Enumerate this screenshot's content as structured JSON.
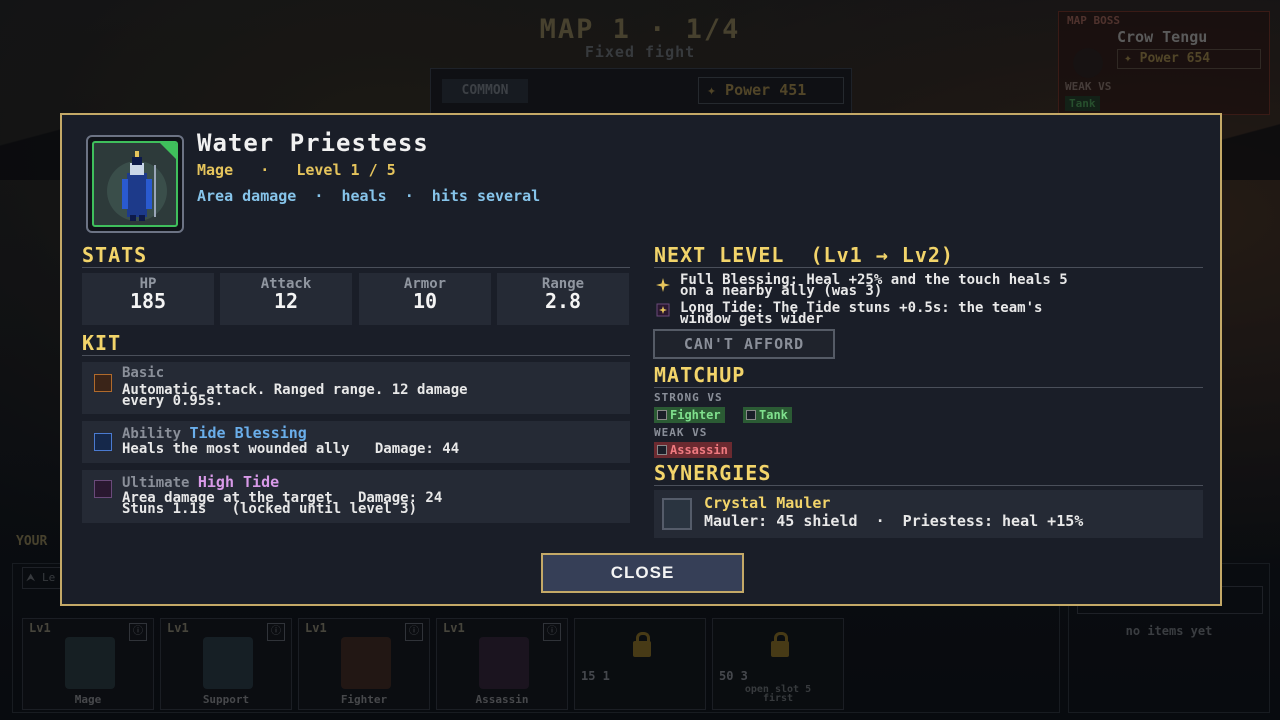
{
  "background": {
    "map_title": "MAP 1  ·  1/4",
    "map_subtitle": "Fixed fight",
    "rarity": "COMMON",
    "power": "✦ Power 451",
    "boss": {
      "label": "MAP BOSS",
      "name": "Crow Tengu",
      "power": "✦ Power 654",
      "weak_label": "WEAK VS",
      "weak_tag": "Tank"
    },
    "team_label": "YOUR",
    "team_tab": "⮝ Le",
    "slots": [
      {
        "level": "Lv1",
        "info": "ⓘ",
        "name": "Mage"
      },
      {
        "level": "Lv1",
        "info": "ⓘ",
        "name": "Support"
      },
      {
        "level": "Lv1",
        "info": "ⓘ",
        "name": "Fighter"
      },
      {
        "level": "Lv1",
        "info": "ⓘ",
        "name": "Assassin"
      }
    ],
    "locked_slots": [
      {
        "cost": "15 1",
        "note": ""
      },
      {
        "cost": "50 3",
        "note": "open slot 5\nfirst"
      }
    ],
    "items_empty": "no items yet"
  },
  "modal": {
    "unit_name": "Water Priestess",
    "unit_class": "Mage   ·   Level 1 / 5",
    "unit_tags": "Area damage  ·  heals  ·  hits several",
    "stats_title": "STATS",
    "stats": [
      {
        "label": "HP",
        "value": "185"
      },
      {
        "label": "Attack",
        "value": "12"
      },
      {
        "label": "Armor",
        "value": "10"
      },
      {
        "label": "Range",
        "value": "2.8"
      }
    ],
    "kit_title": "KIT",
    "kit": {
      "basic_type": "Basic",
      "basic_text": "Automatic attack. Ranged range. 12 damage\nevery 0.95s.",
      "ability_type": "Ability ",
      "ability_name": "Tide Blessing",
      "ability_text": "Heals the most wounded ally   Damage: 44",
      "ult_type": "Ultimate ",
      "ult_name": "High Tide",
      "ult_text": "Area damage at the target   Damage: 24\nStuns 1.1s   (locked until level 3)"
    },
    "next_title": "NEXT LEVEL  (Lv1 → Lv2)",
    "upgrades": [
      "Full Blessing: Heal +25% and the touch heals 5\non a nearby ally (was 3)",
      "Long Tide: The Tide stuns +0.5s: the team's\nwindow gets wider"
    ],
    "afford_label": "CAN'T AFFORD",
    "matchup_title": "MATCHUP",
    "strong_label": "STRONG VS",
    "strong_tags": [
      "Fighter",
      "Tank"
    ],
    "weak_label": "WEAK VS",
    "weak_tags": [
      "Assassin"
    ],
    "synergies_title": "SYNERGIES",
    "synergy": {
      "name": "Crystal Mauler",
      "desc": "Mauler: 45 shield  ·  Priestess: heal +15%"
    },
    "close_label": "CLOSE"
  },
  "colors": {
    "accent_gold": "#c4a967",
    "title_yellow": "#f2d46a",
    "ability_blue": "#6aaeea",
    "ultimate_purple": "#d89ae8",
    "strong_green": "#2b5b34",
    "weak_red": "#6b2a30"
  }
}
